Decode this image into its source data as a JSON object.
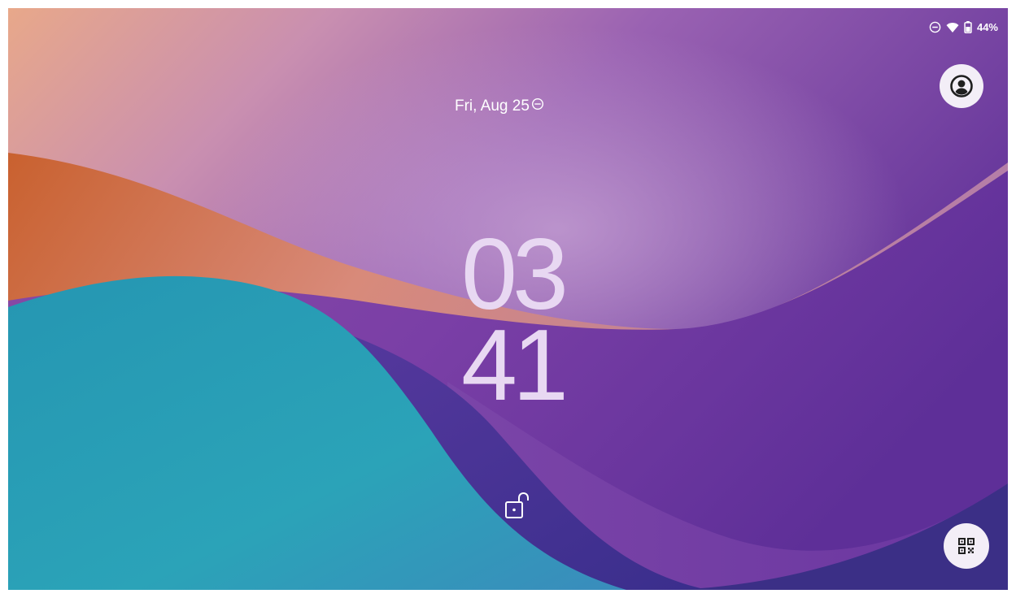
{
  "status_bar": {
    "battery_text": "44%",
    "icons": [
      "do-not-disturb-icon",
      "wifi-icon",
      "battery-icon"
    ]
  },
  "lockscreen": {
    "date": "Fri, Aug 25",
    "clock_hours": "03",
    "clock_minutes": "41"
  },
  "actions": {
    "user_icon": "user-account-icon",
    "lock_icon": "unlock-icon",
    "qr_icon": "qr-code-scanner-icon"
  },
  "colors": {
    "clock": "#e8d8f2",
    "teal": "#2ba3b8",
    "purple": "#6a3aa0",
    "orange": "#d6784a",
    "button_bg": "#f3eef7"
  }
}
